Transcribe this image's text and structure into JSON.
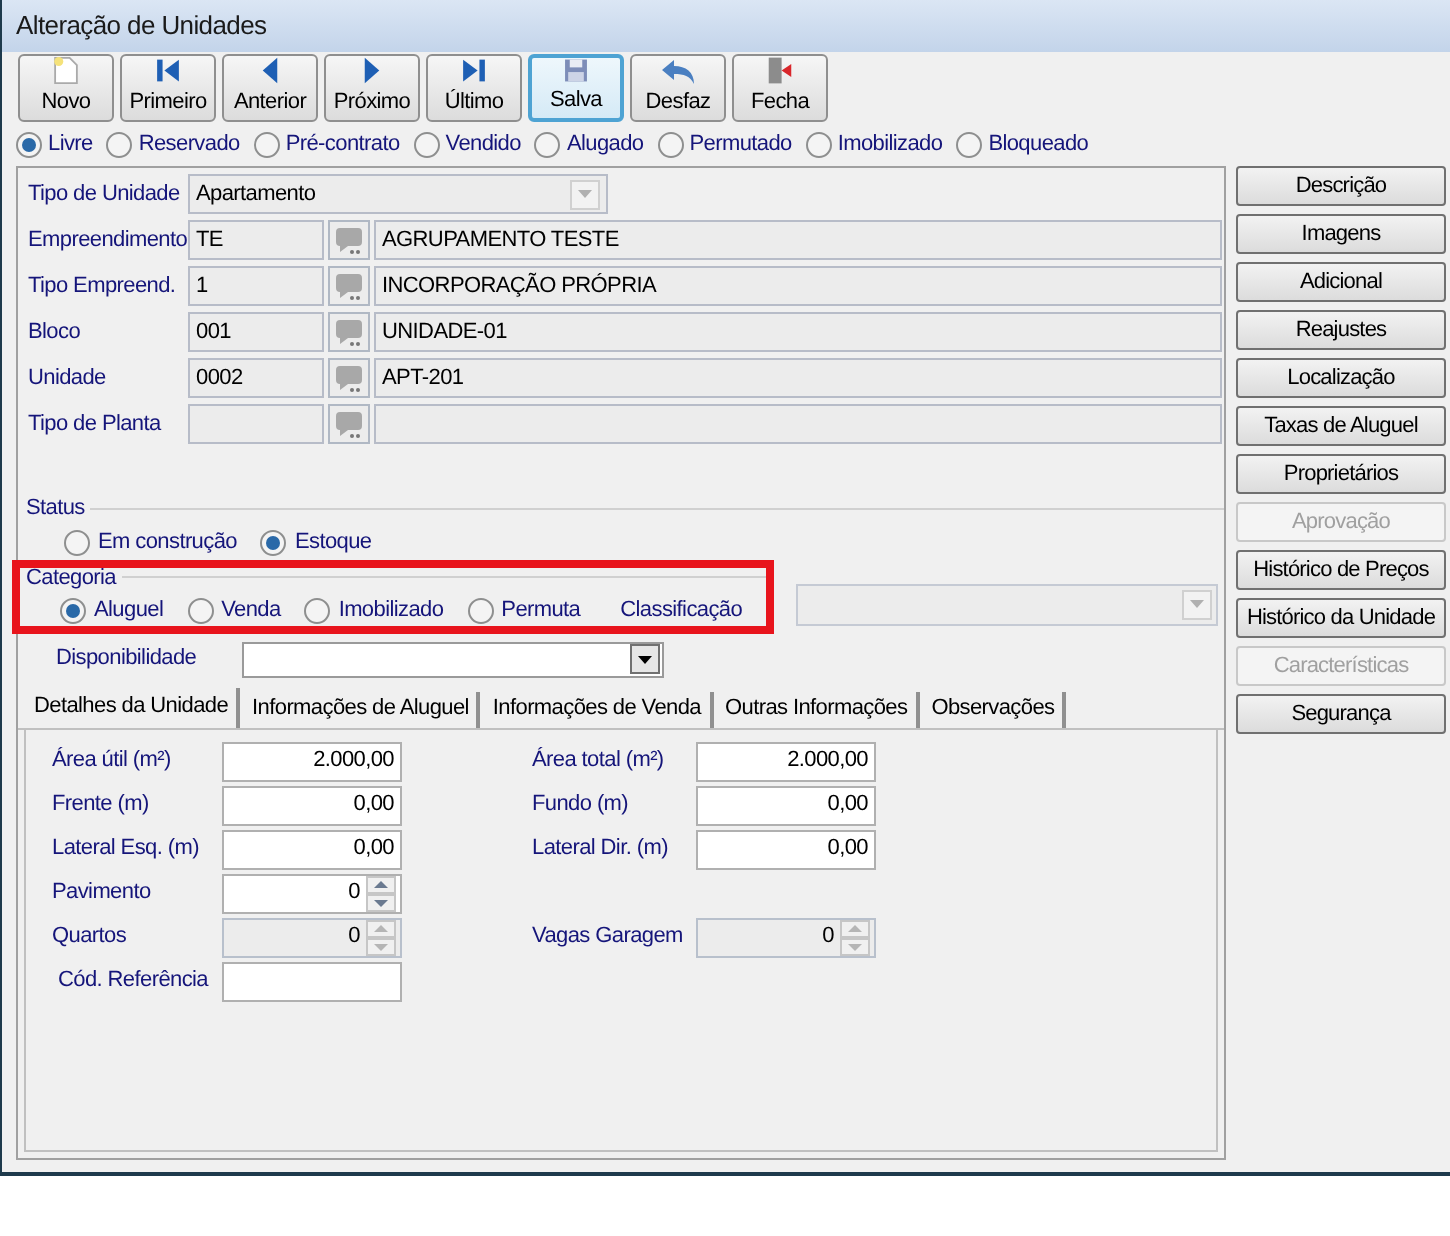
{
  "window": {
    "title": "Alteração de Unidades"
  },
  "toolbar": [
    {
      "label": "Novo",
      "focused": false
    },
    {
      "label": "Primeiro",
      "focused": false
    },
    {
      "label": "Anterior",
      "focused": false
    },
    {
      "label": "Próximo",
      "focused": false
    },
    {
      "label": "Último",
      "focused": false
    },
    {
      "label": "Salva",
      "focused": true
    },
    {
      "label": "Desfaz",
      "focused": false
    },
    {
      "label": "Fecha",
      "focused": false
    }
  ],
  "situation": [
    {
      "label": "Livre",
      "selected": true
    },
    {
      "label": "Reservado",
      "selected": false
    },
    {
      "label": "Pré-contrato",
      "selected": false
    },
    {
      "label": "Vendido",
      "selected": false
    },
    {
      "label": "Alugado",
      "selected": false
    },
    {
      "label": "Permutado",
      "selected": false
    },
    {
      "label": "Imobilizado",
      "selected": false
    },
    {
      "label": "Bloqueado",
      "selected": false
    }
  ],
  "unit_type": {
    "label": "Tipo de Unidade",
    "value": "Apartamento"
  },
  "lookups": [
    {
      "label": "Empreendimento",
      "code": "TE",
      "description": "AGRUPAMENTO TESTE"
    },
    {
      "label": "Tipo Empreend.",
      "code": "1",
      "description": "INCORPORAÇÃO PRÓPRIA"
    },
    {
      "label": "Bloco",
      "code": "001",
      "description": "UNIDADE-01"
    },
    {
      "label": "Unidade",
      "code": "0002",
      "description": "APT-201"
    },
    {
      "label": "Tipo de Planta"
    }
  ],
  "status": {
    "title": "Status",
    "options": [
      {
        "label": "Em construção",
        "selected": false
      },
      {
        "label": "Estoque",
        "selected": true
      }
    ]
  },
  "category": {
    "title": "Categoria",
    "highlighted": true,
    "options": [
      {
        "label": "Aluguel",
        "selected": true
      },
      {
        "label": "Venda",
        "selected": false
      },
      {
        "label": "Imobilizado",
        "selected": false
      },
      {
        "label": "Permuta",
        "selected": false
      }
    ],
    "classification_label": "Classificação"
  },
  "availability": {
    "label": "Disponibilidade"
  },
  "tabs": [
    {
      "label": "Detalhes da Unidade",
      "selected": true
    },
    {
      "label": "Informações de Aluguel",
      "selected": false
    },
    {
      "label": "Informações de Venda",
      "selected": false
    },
    {
      "label": "Outras Informações",
      "selected": false
    },
    {
      "label": "Observações",
      "selected": false
    }
  ],
  "details": [
    [
      {
        "label": "Área útil (m²)",
        "value": "2.000,00",
        "kind": "text"
      },
      {
        "label": "Área total (m²)",
        "value": "2.000,00",
        "kind": "text"
      }
    ],
    [
      {
        "label": "Frente (m)",
        "value": "0,00",
        "kind": "text"
      },
      {
        "label": "Fundo (m)",
        "value": "0,00",
        "kind": "text"
      }
    ],
    [
      {
        "label": "Lateral Esq. (m)",
        "value": "0,00",
        "kind": "text"
      },
      {
        "label": "Lateral Dir. (m)",
        "value": "0,00",
        "kind": "text"
      }
    ],
    [
      {
        "label": "Pavimento",
        "value": "0",
        "kind": "spin",
        "disabled": false
      }
    ],
    [
      {
        "label": "Quartos",
        "value": "0",
        "kind": "spin",
        "disabled": true
      },
      {
        "label": "Vagas Garagem",
        "value": "0",
        "kind": "spin",
        "disabled": true
      }
    ],
    [
      {
        "label": "Cód. Referência",
        "kind": "text"
      }
    ]
  ],
  "side_buttons": [
    {
      "label": "Descrição",
      "disabled": false
    },
    {
      "label": "Imagens",
      "disabled": false
    },
    {
      "label": "Adicional",
      "disabled": false
    },
    {
      "label": "Reajustes",
      "disabled": false
    },
    {
      "label": "Localização",
      "disabled": false
    },
    {
      "label": "Taxas de Aluguel",
      "disabled": false
    },
    {
      "label": "Proprietários",
      "disabled": false
    },
    {
      "label": "Aprovação",
      "disabled": true
    },
    {
      "label": "Histórico de Preços",
      "disabled": false
    },
    {
      "label": "Histórico da Unidade",
      "disabled": false
    },
    {
      "label": "Características",
      "disabled": true
    },
    {
      "label": "Segurança",
      "disabled": false
    }
  ]
}
